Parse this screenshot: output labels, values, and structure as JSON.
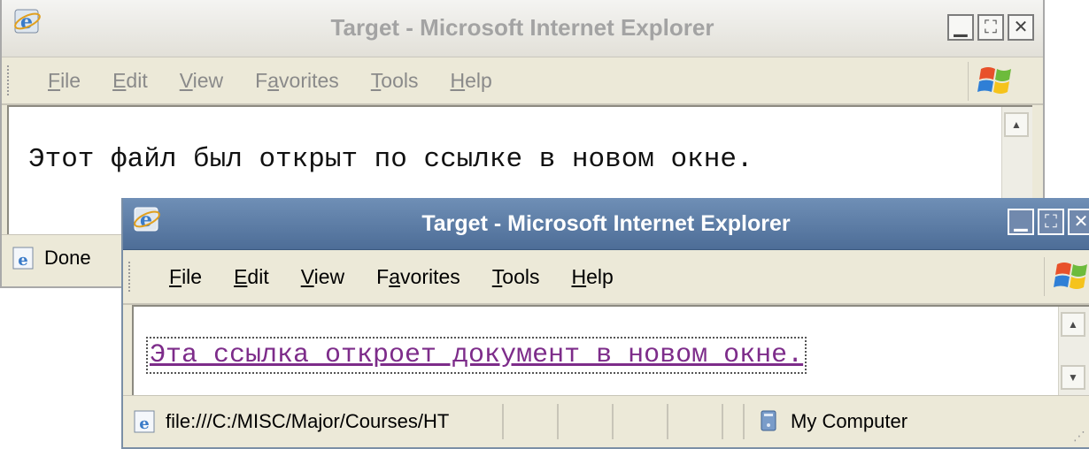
{
  "back_window": {
    "title": "Target - Microsoft Internet Explorer",
    "menu": {
      "file_prefix": "",
      "file_u": "F",
      "file_rest": "ile",
      "edit_prefix": "",
      "edit_u": "E",
      "edit_rest": "dit",
      "view_prefix": "",
      "view_u": "V",
      "view_rest": "iew",
      "favorites_prefix": "F",
      "favorites_u": "a",
      "favorites_rest": "vorites",
      "tools_prefix": "",
      "tools_u": "T",
      "tools_rest": "ools",
      "help_prefix": "",
      "help_u": "H",
      "help_rest": "elp"
    },
    "document_text": "Этот файл был открыт по ссылке в новом окне.",
    "status_text": "Done"
  },
  "front_window": {
    "title": "Target - Microsoft Internet Explorer",
    "menu": {
      "file_prefix": "",
      "file_u": "F",
      "file_rest": "ile",
      "edit_prefix": "",
      "edit_u": "E",
      "edit_rest": "dit",
      "view_prefix": "",
      "view_u": "V",
      "view_rest": "iew",
      "favorites_prefix": "F",
      "favorites_u": "a",
      "favorites_rest": "vorites",
      "tools_prefix": "",
      "tools_u": "T",
      "tools_rest": "ools",
      "help_prefix": "",
      "help_u": "H",
      "help_rest": "elp"
    },
    "link_text": "Эта ссылка откроет документ в новом окне.",
    "status_url": "file:///C:/MISC/Major/Courses/HT",
    "status_zone": "My Computer"
  },
  "colors": {
    "link_visited": "#7d2c8a",
    "active_title_bar": "#5a7aa5",
    "inactive_title_text": "#a3a3a3"
  }
}
